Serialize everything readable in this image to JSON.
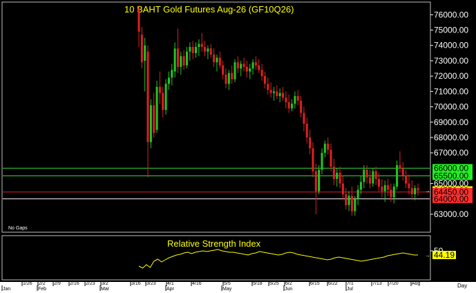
{
  "colors": {
    "background": "#000000",
    "panel_border": "#c0c0c0",
    "title": "#ffff00",
    "axis_text": "#ffffff",
    "up_candle": "#22c822",
    "down_candle": "#e02020",
    "support_line": "#33dd33",
    "resistance_line": "#dd2222",
    "white_line": "#ffffff",
    "rsi_line": "#ffff00",
    "green_tag": "#22ee22",
    "red_tag": "#ff3030",
    "yellow_tag": "#ffff00",
    "bottom_bar": "#ffffff"
  },
  "chart_data": [
    {
      "type": "candlestick",
      "title": "10 BAHT  Gold  Futures  Aug-26  (GF10Q26)",
      "note": "No  Gaps",
      "y_ticks": [
        "76000.00",
        "75000.00",
        "74000.00",
        "73000.00",
        "72000.00",
        "71000.00",
        "70000.00",
        "69000.00",
        "68000.00",
        "67000.00",
        "66000.00",
        "65500.00",
        "65000.00",
        "64550.00",
        "64450.00",
        "64000.00",
        "63000.00"
      ],
      "ylim": [
        62100,
        76600
      ],
      "price_tags": [
        {
          "value": 66000,
          "label": "66000.00",
          "style": "green"
        },
        {
          "value": 65500,
          "label": "65500.00",
          "style": "green"
        },
        {
          "value": 64550,
          "label": "64550.00",
          "style": "yellow"
        },
        {
          "value": 64450,
          "label": "64450.00",
          "style": "red"
        },
        {
          "value": 64000,
          "label": "64000.00",
          "style": "red"
        }
      ],
      "horizontal_lines": [
        {
          "value": 66000,
          "color": "green"
        },
        {
          "value": 65500,
          "color": "green"
        },
        {
          "value": 64450,
          "color": "red"
        },
        {
          "value": 64000,
          "color": "white"
        }
      ],
      "ohlc": [
        {
          "d": "3/16",
          "o": 76400,
          "h": 76600,
          "l": 73900,
          "c": 74900
        },
        {
          "d": "3/17",
          "o": 74700,
          "h": 75200,
          "l": 72500,
          "c": 72900
        },
        {
          "d": "3/18",
          "o": 73000,
          "h": 74500,
          "l": 71000,
          "c": 74000
        },
        {
          "d": "3/19",
          "o": 73600,
          "h": 74000,
          "l": 65400,
          "c": 67700
        },
        {
          "d": "3/20",
          "o": 67700,
          "h": 70500,
          "l": 67300,
          "c": 70100
        },
        {
          "d": "3/23",
          "o": 70100,
          "h": 70900,
          "l": 68000,
          "c": 68300
        },
        {
          "d": "3/24",
          "o": 68500,
          "h": 71700,
          "l": 68300,
          "c": 71300
        },
        {
          "d": "3/25",
          "o": 71300,
          "h": 72300,
          "l": 70200,
          "c": 70900
        },
        {
          "d": "3/26",
          "o": 70900,
          "h": 71300,
          "l": 69300,
          "c": 69800
        },
        {
          "d": "3/27",
          "o": 69800,
          "h": 71800,
          "l": 69500,
          "c": 71500
        },
        {
          "d": "3/30",
          "o": 71500,
          "h": 72300,
          "l": 71100,
          "c": 71900
        },
        {
          "d": "3/31",
          "o": 71900,
          "h": 72800,
          "l": 71400,
          "c": 72400
        },
        {
          "d": "4/1",
          "o": 72300,
          "h": 74200,
          "l": 71900,
          "c": 73800
        },
        {
          "d": "4/2",
          "o": 73800,
          "h": 75100,
          "l": 72200,
          "c": 72600
        },
        {
          "d": "4/3",
          "o": 72600,
          "h": 73600,
          "l": 72100,
          "c": 73300
        },
        {
          "d": "4/6",
          "o": 73300,
          "h": 73700,
          "l": 72400,
          "c": 72700
        },
        {
          "d": "4/7",
          "o": 72700,
          "h": 73900,
          "l": 72500,
          "c": 73600
        },
        {
          "d": "4/8",
          "o": 73600,
          "h": 74200,
          "l": 73000,
          "c": 73900
        },
        {
          "d": "4/9",
          "o": 73900,
          "h": 74300,
          "l": 73100,
          "c": 73500
        },
        {
          "d": "4/10",
          "o": 73500,
          "h": 74200,
          "l": 73200,
          "c": 73900
        },
        {
          "d": "4/13",
          "o": 73900,
          "h": 74400,
          "l": 73300,
          "c": 74100
        },
        {
          "d": "4/14",
          "o": 74100,
          "h": 74800,
          "l": 73600,
          "c": 73900
        },
        {
          "d": "4/15",
          "o": 73900,
          "h": 74300,
          "l": 73300,
          "c": 73600
        },
        {
          "d": "4/16",
          "o": 73600,
          "h": 74000,
          "l": 73100,
          "c": 73800
        },
        {
          "d": "4/17",
          "o": 73800,
          "h": 74100,
          "l": 73200,
          "c": 73400
        },
        {
          "d": "4/20",
          "o": 73400,
          "h": 73800,
          "l": 72600,
          "c": 72900
        },
        {
          "d": "4/21",
          "o": 72900,
          "h": 73400,
          "l": 72300,
          "c": 73200
        },
        {
          "d": "4/22",
          "o": 73200,
          "h": 73600,
          "l": 72500,
          "c": 72700
        },
        {
          "d": "4/23",
          "o": 72700,
          "h": 73000,
          "l": 71800,
          "c": 72100
        },
        {
          "d": "4/24",
          "o": 72100,
          "h": 72500,
          "l": 71200,
          "c": 71500
        },
        {
          "d": "4/27",
          "o": 71500,
          "h": 72400,
          "l": 71100,
          "c": 72200
        },
        {
          "d": "4/28",
          "o": 72200,
          "h": 72700,
          "l": 71500,
          "c": 71800
        },
        {
          "d": "4/29",
          "o": 71800,
          "h": 73100,
          "l": 71600,
          "c": 72900
        },
        {
          "d": "4/30",
          "o": 72900,
          "h": 73300,
          "l": 72200,
          "c": 72500
        },
        {
          "d": "5/1",
          "o": 72500,
          "h": 73000,
          "l": 72000,
          "c": 72800
        },
        {
          "d": "5/4",
          "o": 72800,
          "h": 73200,
          "l": 72300,
          "c": 72600
        },
        {
          "d": "5/5",
          "o": 72600,
          "h": 73000,
          "l": 71900,
          "c": 72300
        },
        {
          "d": "5/6",
          "o": 72300,
          "h": 72800,
          "l": 71800,
          "c": 72500
        },
        {
          "d": "5/7",
          "o": 72500,
          "h": 73100,
          "l": 72100,
          "c": 72900
        },
        {
          "d": "5/8",
          "o": 72900,
          "h": 73300,
          "l": 72400,
          "c": 72700
        },
        {
          "d": "5/11",
          "o": 72700,
          "h": 73100,
          "l": 72200,
          "c": 72400
        },
        {
          "d": "5/12",
          "o": 72400,
          "h": 72800,
          "l": 71700,
          "c": 72000
        },
        {
          "d": "5/13",
          "o": 72000,
          "h": 72300,
          "l": 71200,
          "c": 71500
        },
        {
          "d": "5/14",
          "o": 71500,
          "h": 71900,
          "l": 70800,
          "c": 71100
        },
        {
          "d": "5/15",
          "o": 71100,
          "h": 71600,
          "l": 70600,
          "c": 70900
        },
        {
          "d": "5/18",
          "o": 70900,
          "h": 71300,
          "l": 70400,
          "c": 71000
        },
        {
          "d": "5/19",
          "o": 71000,
          "h": 71400,
          "l": 70500,
          "c": 70700
        },
        {
          "d": "5/20",
          "o": 70700,
          "h": 71200,
          "l": 70300,
          "c": 70900
        },
        {
          "d": "5/21",
          "o": 70900,
          "h": 71300,
          "l": 70400,
          "c": 70600
        },
        {
          "d": "5/22",
          "o": 70600,
          "h": 71000,
          "l": 69900,
          "c": 70300
        },
        {
          "d": "5/25",
          "o": 70300,
          "h": 70800,
          "l": 69600,
          "c": 69900
        },
        {
          "d": "5/26",
          "o": 69900,
          "h": 70500,
          "l": 69700,
          "c": 70200
        },
        {
          "d": "5/27",
          "o": 70200,
          "h": 71000,
          "l": 69900,
          "c": 70700
        },
        {
          "d": "5/28",
          "o": 70700,
          "h": 71100,
          "l": 70100,
          "c": 70400
        },
        {
          "d": "5/29",
          "o": 70400,
          "h": 70700,
          "l": 69300,
          "c": 69600
        },
        {
          "d": "6/1",
          "o": 69600,
          "h": 70000,
          "l": 68400,
          "c": 68900
        },
        {
          "d": "6/2",
          "o": 68900,
          "h": 69300,
          "l": 67600,
          "c": 68000
        },
        {
          "d": "6/3",
          "o": 68000,
          "h": 68500,
          "l": 66900,
          "c": 67300
        },
        {
          "d": "6/4",
          "o": 67300,
          "h": 67700,
          "l": 65400,
          "c": 65800
        },
        {
          "d": "6/5",
          "o": 65800,
          "h": 66300,
          "l": 63000,
          "c": 64500
        },
        {
          "d": "6/8",
          "o": 64500,
          "h": 66200,
          "l": 64300,
          "c": 65900
        },
        {
          "d": "6/9",
          "o": 65900,
          "h": 67300,
          "l": 65600,
          "c": 67000
        },
        {
          "d": "6/10",
          "o": 67000,
          "h": 67800,
          "l": 66700,
          "c": 67600
        },
        {
          "d": "6/11",
          "o": 67600,
          "h": 68000,
          "l": 66900,
          "c": 67200
        },
        {
          "d": "6/12",
          "o": 67200,
          "h": 67600,
          "l": 65800,
          "c": 66100
        },
        {
          "d": "6/15",
          "o": 66100,
          "h": 66600,
          "l": 64900,
          "c": 65300
        },
        {
          "d": "6/16",
          "o": 65300,
          "h": 66000,
          "l": 64800,
          "c": 65700
        },
        {
          "d": "6/17",
          "o": 65700,
          "h": 66100,
          "l": 64700,
          "c": 65000
        },
        {
          "d": "6/18",
          "o": 65000,
          "h": 65500,
          "l": 64000,
          "c": 64300
        },
        {
          "d": "6/19",
          "o": 64300,
          "h": 64700,
          "l": 63300,
          "c": 63600
        },
        {
          "d": "6/22",
          "o": 63600,
          "h": 64500,
          "l": 63200,
          "c": 64200
        },
        {
          "d": "6/23",
          "o": 64200,
          "h": 64800,
          "l": 62900,
          "c": 63200
        },
        {
          "d": "6/24",
          "o": 63200,
          "h": 64200,
          "l": 62900,
          "c": 64000
        },
        {
          "d": "6/25",
          "o": 64000,
          "h": 64900,
          "l": 63600,
          "c": 64600
        },
        {
          "d": "6/26",
          "o": 64600,
          "h": 65500,
          "l": 64300,
          "c": 65100
        },
        {
          "d": "6/29",
          "o": 65100,
          "h": 66200,
          "l": 64700,
          "c": 65900
        },
        {
          "d": "6/30",
          "o": 65900,
          "h": 66200,
          "l": 65000,
          "c": 65400
        },
        {
          "d": "7/1",
          "o": 65400,
          "h": 65900,
          "l": 64700,
          "c": 65000
        },
        {
          "d": "7/2",
          "o": 65000,
          "h": 66000,
          "l": 64800,
          "c": 65800
        },
        {
          "d": "7/3",
          "o": 65800,
          "h": 66100,
          "l": 64900,
          "c": 65300
        },
        {
          "d": "7/6",
          "o": 65300,
          "h": 65700,
          "l": 64500,
          "c": 64800
        },
        {
          "d": "7/7",
          "o": 64800,
          "h": 65300,
          "l": 64100,
          "c": 64500
        },
        {
          "d": "7/8",
          "o": 64500,
          "h": 65200,
          "l": 63800,
          "c": 64900
        },
        {
          "d": "7/9",
          "o": 64900,
          "h": 65300,
          "l": 64200,
          "c": 64600
        },
        {
          "d": "7/10",
          "o": 64600,
          "h": 65000,
          "l": 63800,
          "c": 64100
        },
        {
          "d": "7/13",
          "o": 64100,
          "h": 65000,
          "l": 63700,
          "c": 64800
        },
        {
          "d": "7/14",
          "o": 64800,
          "h": 66500,
          "l": 64600,
          "c": 66200
        },
        {
          "d": "7/15",
          "o": 66200,
          "h": 67100,
          "l": 65700,
          "c": 66000
        },
        {
          "d": "7/16",
          "o": 66000,
          "h": 66400,
          "l": 65200,
          "c": 65500
        },
        {
          "d": "7/17",
          "o": 65500,
          "h": 65900,
          "l": 64700,
          "c": 65000
        },
        {
          "d": "7/20",
          "o": 65000,
          "h": 65600,
          "l": 64300,
          "c": 64700
        },
        {
          "d": "7/21",
          "o": 64700,
          "h": 65200,
          "l": 64000,
          "c": 64300
        },
        {
          "d": "7/22",
          "o": 64300,
          "h": 64900,
          "l": 63900,
          "c": 64700
        },
        {
          "d": "7/23",
          "o": 64700,
          "h": 65000,
          "l": 64200,
          "c": 64550
        }
      ]
    },
    {
      "type": "line",
      "title": "Relative  Strength  Index",
      "y_ticks": [
        "50"
      ],
      "last_value_label": "44.19",
      "ylim": [
        10,
        70
      ],
      "values": [
        28,
        25,
        30,
        26,
        35,
        38,
        34,
        37,
        40,
        42,
        44,
        45,
        47,
        48,
        46,
        48,
        49,
        50,
        49,
        50,
        51,
        52,
        50,
        49,
        48,
        48,
        47,
        46,
        45,
        44,
        46,
        47,
        49,
        48,
        47,
        46,
        45,
        44,
        45,
        47,
        48,
        47,
        45,
        44,
        43,
        42,
        41,
        40,
        39,
        38,
        37,
        38,
        40,
        41,
        40,
        39,
        38,
        37,
        36,
        35,
        36,
        37,
        38,
        39,
        40,
        41,
        43,
        44,
        45,
        46,
        47,
        46,
        45,
        44,
        44
      ]
    }
  ],
  "x_axis": {
    "labels": [
      "1/26",
      "2/2",
      "2/9",
      "2/16",
      "2/23",
      "3/2",
      "3/16",
      "3/23",
      "4/1",
      "4/16",
      "5/5",
      "5/18",
      "5/25",
      "6/2",
      "6/15",
      "6/22",
      "7/1",
      "7/13",
      "7/20",
      "Aug",
      "Jan",
      "Feb",
      "Mar",
      "Apr",
      "May",
      "Jun",
      "Jul"
    ],
    "day_label": "Day"
  }
}
